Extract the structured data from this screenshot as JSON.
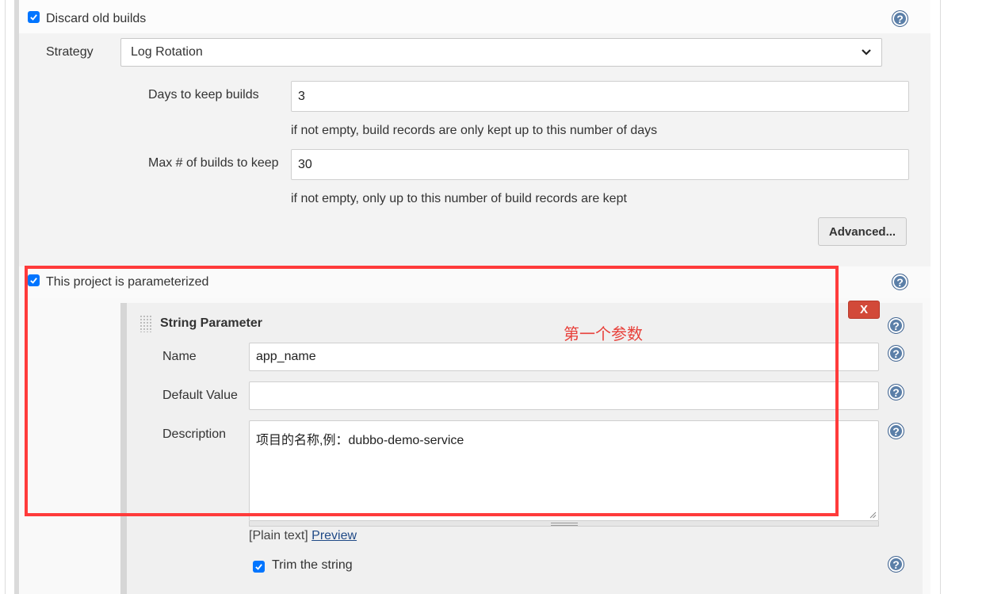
{
  "discard": {
    "checked": true,
    "label": "Discard old builds",
    "strategy_label": "Strategy",
    "strategy_value": "Log Rotation",
    "days_label": "Days to keep builds",
    "days_value": "3",
    "days_hint": "if not empty, build records are only kept up to this number of days",
    "max_label": "Max # of builds to keep",
    "max_value": "30",
    "max_hint": "if not empty, only up to this number of build records are kept",
    "advanced_label": "Advanced..."
  },
  "parameterized": {
    "checked": true,
    "label": "This project is parameterized"
  },
  "string_param": {
    "title": "String Parameter",
    "delete_label": "X",
    "annotation": "第一个参数",
    "name_label": "Name",
    "name_value": "app_name",
    "default_label": "Default Value",
    "default_value": "",
    "description_label": "Description",
    "description_value": "项目的名称,例：dubbo-demo-service",
    "plain_text": "[Plain text]",
    "preview_link": "Preview",
    "trim_label": "Trim the string",
    "trim_checked": true
  },
  "icons": {
    "help": "question-mark-help-icon",
    "check": "checkmark-icon",
    "dropdown": "chevron-down-icon",
    "drag": "drag-handle-icon"
  },
  "colors": {
    "checkbox": "#0075ff",
    "delete_button": "#d24939",
    "annotation_red": "#ff3b3b",
    "help_icon": "#5b7fa8",
    "link": "#204a87"
  }
}
